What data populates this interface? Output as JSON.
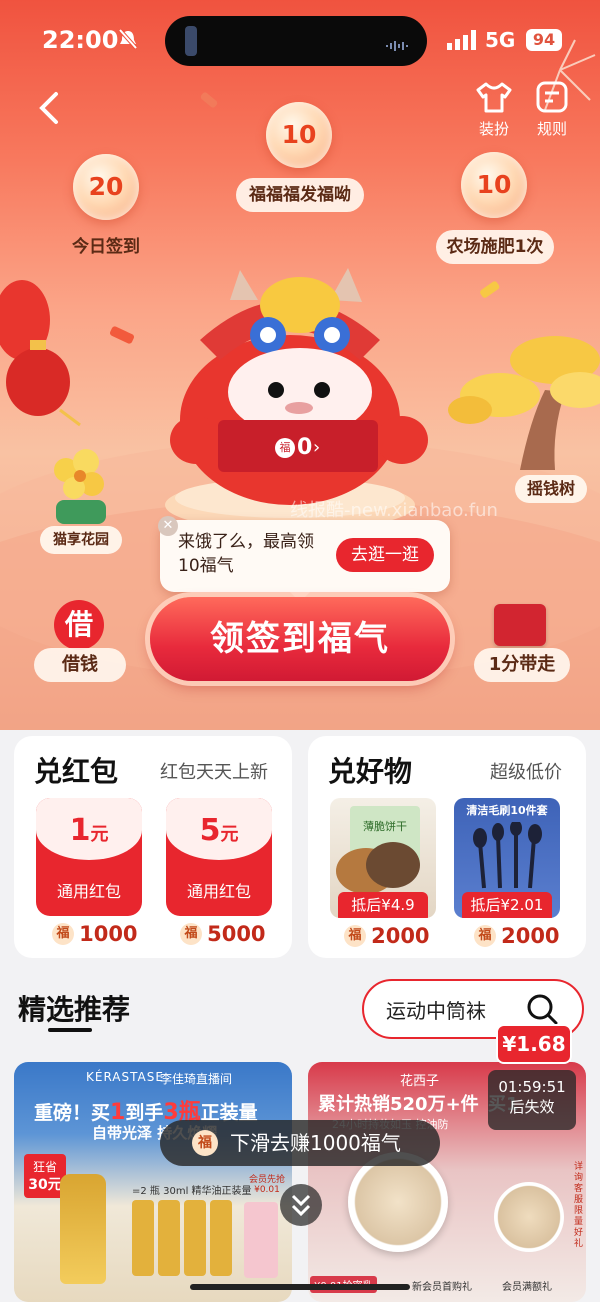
{
  "status_bar": {
    "time": "22:00",
    "network": "5G",
    "battery": "94"
  },
  "nav": {
    "back_icon": "chevron-left-icon",
    "dress_label": "装扮",
    "rules_label": "规则"
  },
  "tasks": [
    {
      "points": "20",
      "label": "今日签到"
    },
    {
      "points": "10",
      "label": "福福福发福呦"
    },
    {
      "points": "10",
      "label": "农场施肥1次"
    }
  ],
  "mascot": {
    "fu_char": "福",
    "count": "0"
  },
  "side_items": {
    "garden": "猫享花园",
    "money_tree": "摇钱树",
    "borrow_icon_char": "借",
    "borrow": "借钱",
    "one_cent": "1分带走"
  },
  "watermark": "线报酷-new.xianbao.fun",
  "tooltip": {
    "text_line1": "来饿了么，最高领",
    "text_line2": "10福气",
    "button": "去逛一逛"
  },
  "cta": {
    "label": "领签到福气"
  },
  "redpack_card": {
    "title": "兑红包",
    "subtitle": "红包天天上新",
    "items": [
      {
        "amount": "1",
        "unit": "元",
        "label": "通用红包",
        "cost": "1000"
      },
      {
        "amount": "5",
        "unit": "元",
        "label": "通用红包",
        "cost": "5000"
      }
    ]
  },
  "goods_card": {
    "title": "兑好物",
    "subtitle": "超级低价",
    "items": [
      {
        "tag": "抵后¥4.9",
        "cost": "2000",
        "banner": "薄脆饼干"
      },
      {
        "tag": "抵后¥2.01",
        "cost": "2000",
        "banner": "清洁毛刷10件套"
      }
    ]
  },
  "recommend": {
    "title": "精选推荐",
    "search_value": "运动中筒袜",
    "price_badge": "¥1.68",
    "countdown": "01:59:51",
    "countdown_suffix": "后失效"
  },
  "feed": [
    {
      "brand": "KÉRASTASE",
      "live": "李佳琦直播间",
      "headline_pre": "重磅！买",
      "headline_num1": "1",
      "headline_mid": "到手",
      "headline_num2": "3瓶",
      "headline_post": "正装量",
      "sub": "自带光泽 持久焕耀",
      "badge_line1": "狂省",
      "badge_line2": "30元",
      "note": "=2 瓶 30ml 精华油正装量",
      "gift": "会员先抢¥0.01"
    },
    {
      "brand": "花西子",
      "headline": "累计热销520万+件",
      "headline2": "买1",
      "sub": "24小时持妆如玉 控油防",
      "bottom1": "¥0.01抢密乳",
      "bottom2": "新会员首购礼",
      "bottom3": "会员满额礼",
      "side_note": "详询客服 限量好礼"
    }
  ],
  "toast": {
    "fu_char": "福",
    "text": "下滑去赚1000福气"
  },
  "colors": {
    "brand_red": "#e8262e",
    "hero_top": "#f0533f",
    "gold": "#f7c844"
  }
}
